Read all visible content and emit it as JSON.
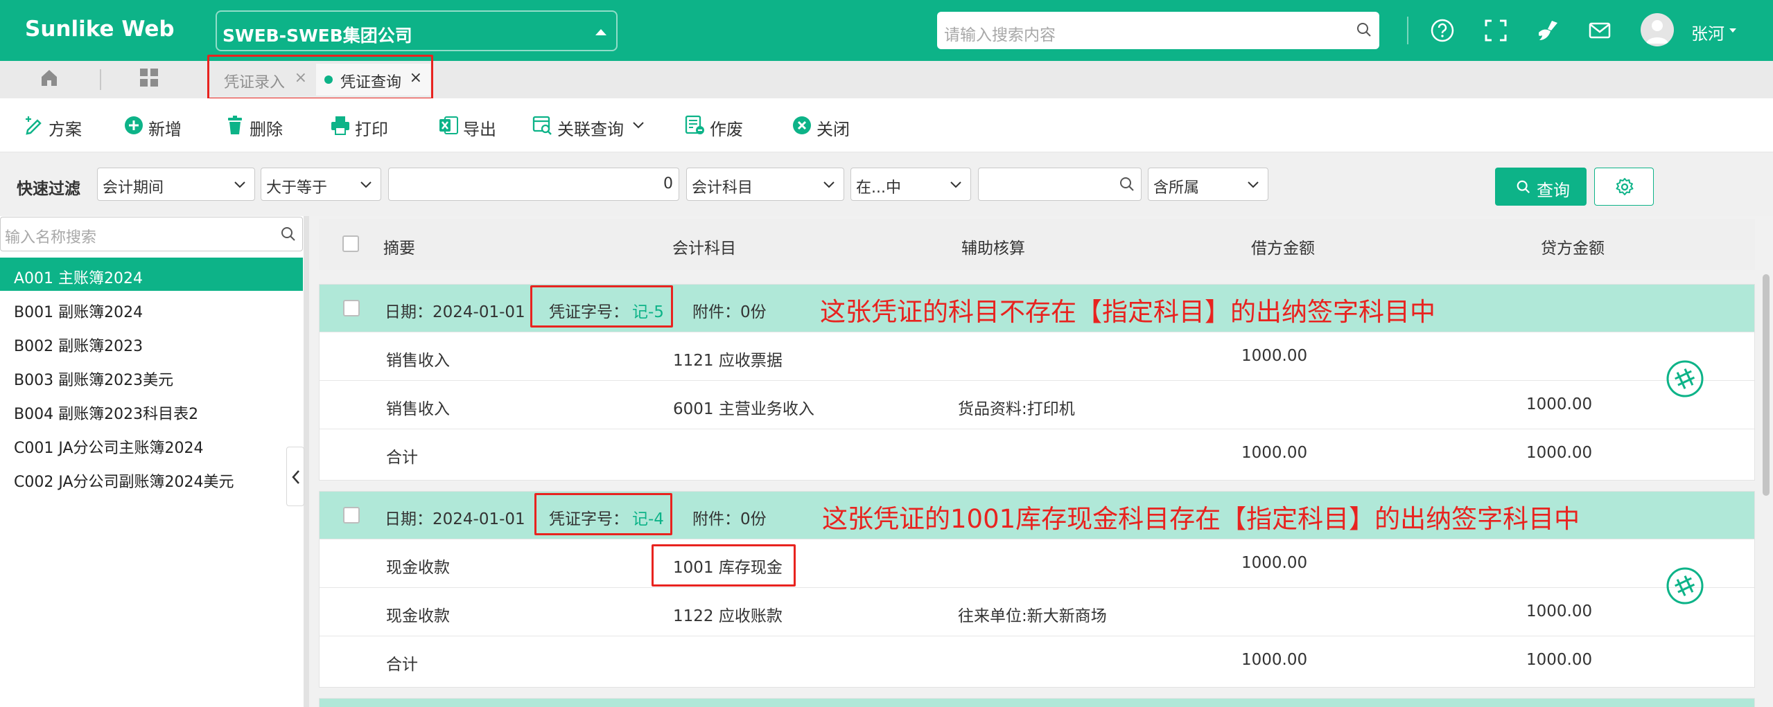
{
  "header": {
    "brand": "Sunlike Web",
    "company": "SWEB-SWEB集团公司",
    "search_placeholder": "请输入搜索内容",
    "username": "张河",
    "icons": [
      "help-icon",
      "fullscreen-icon",
      "broom-icon",
      "mail-icon",
      "avatar-icon"
    ]
  },
  "tabs": [
    {
      "label": "凭证录入",
      "active": false
    },
    {
      "label": "凭证查询",
      "active": true
    }
  ],
  "toolbar": {
    "scheme": "方案",
    "add": "新增",
    "delete": "删除",
    "print": "打印",
    "export": "导出",
    "related": "关联查询",
    "void": "作废",
    "close": "关闭"
  },
  "filter": {
    "label": "快速过滤",
    "field1": "会计期间",
    "op1": "大于等于",
    "value1": "0",
    "field2": "会计科目",
    "op2": "在...中",
    "value2": "",
    "scope": "含所属",
    "query": "查询"
  },
  "left": {
    "search_placeholder": "输入名称搜索",
    "items": [
      "A001 主账簿2024",
      "B001 副账簿2024",
      "B002 副账簿2023",
      "B003 副账簿2023美元",
      "B004 副账簿2023科目表2",
      "C001 JA分公司主账簿2024",
      "C002 JA分公司副账簿2024美元"
    ]
  },
  "table": {
    "columns": [
      "摘要",
      "会计科目",
      "辅助核算",
      "借方金额",
      "贷方金额"
    ]
  },
  "vouchers": [
    {
      "date_label": "日期：2024-01-01",
      "no_label": "凭证字号：",
      "no": "记-5",
      "attach": "附件：0份",
      "annotation": "这张凭证的科目不存在【指定科目】的出纳签字科目中",
      "rows": [
        {
          "summary": "销售收入",
          "account": "1121 应收票据",
          "aux": "",
          "debit": "1000.00",
          "credit": ""
        },
        {
          "summary": "销售收入",
          "account": "6001 主营业务收入",
          "aux": "货品资料:打印机",
          "debit": "",
          "credit": "1000.00"
        },
        {
          "summary": "合计",
          "account": "",
          "aux": "",
          "debit": "1000.00",
          "credit": "1000.00"
        }
      ]
    },
    {
      "date_label": "日期：2024-01-01",
      "no_label": "凭证字号：",
      "no": "记-4",
      "attach": "附件：0份",
      "annotation": "这张凭证的1001库存现金科目存在【指定科目】的出纳签字科目中",
      "rows": [
        {
          "summary": "现金收款",
          "account": "1001 库存现金",
          "aux": "",
          "debit": "1000.00",
          "credit": ""
        },
        {
          "summary": "现金收款",
          "account": "1122 应收账款",
          "aux": "往来单位:新大新商场",
          "debit": "",
          "credit": "1000.00"
        },
        {
          "summary": "合计",
          "account": "",
          "aux": "",
          "debit": "1000.00",
          "credit": "1000.00"
        }
      ]
    }
  ],
  "colors": {
    "brand": "#0db388",
    "row_header": "#b0e8d8",
    "annotation": "#e8231f"
  }
}
